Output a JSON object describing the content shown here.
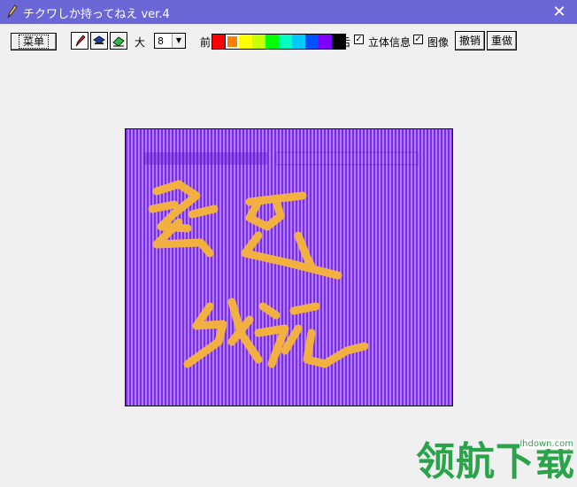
{
  "titlebar": {
    "title": "チクワしか持ってねえ ver.4",
    "close_glyph": "✕"
  },
  "toolbar": {
    "menu_label": "菜单",
    "tools": [
      {
        "icon": "pencil-icon",
        "selected": true
      },
      {
        "icon": "fill-icon",
        "selected": false
      },
      {
        "icon": "eraser-icon",
        "selected": false
      }
    ],
    "size_label": "大",
    "size_value": "8",
    "front_label": "前",
    "palette": [
      "#ff0000",
      "#ff8000",
      "#ffff00",
      "#c8ff00",
      "#00ff00",
      "#00ffc0",
      "#00c8ff",
      "#0050ff",
      "#8000ff",
      "#000000"
    ],
    "back_label": "后",
    "stereo_label": "立体信息",
    "stereo_checked": true,
    "image_label": "图像",
    "image_checked": true,
    "undo_label": "撤销",
    "redo_label": "重做"
  },
  "canvas": {
    "background_colors": [
      "#7a2ce8",
      "#b07cf5"
    ],
    "stroke_color": "#f2b040"
  },
  "watermark": {
    "text": "领航下载",
    "url": "lhdown.com",
    "color": "#2aa34a"
  }
}
